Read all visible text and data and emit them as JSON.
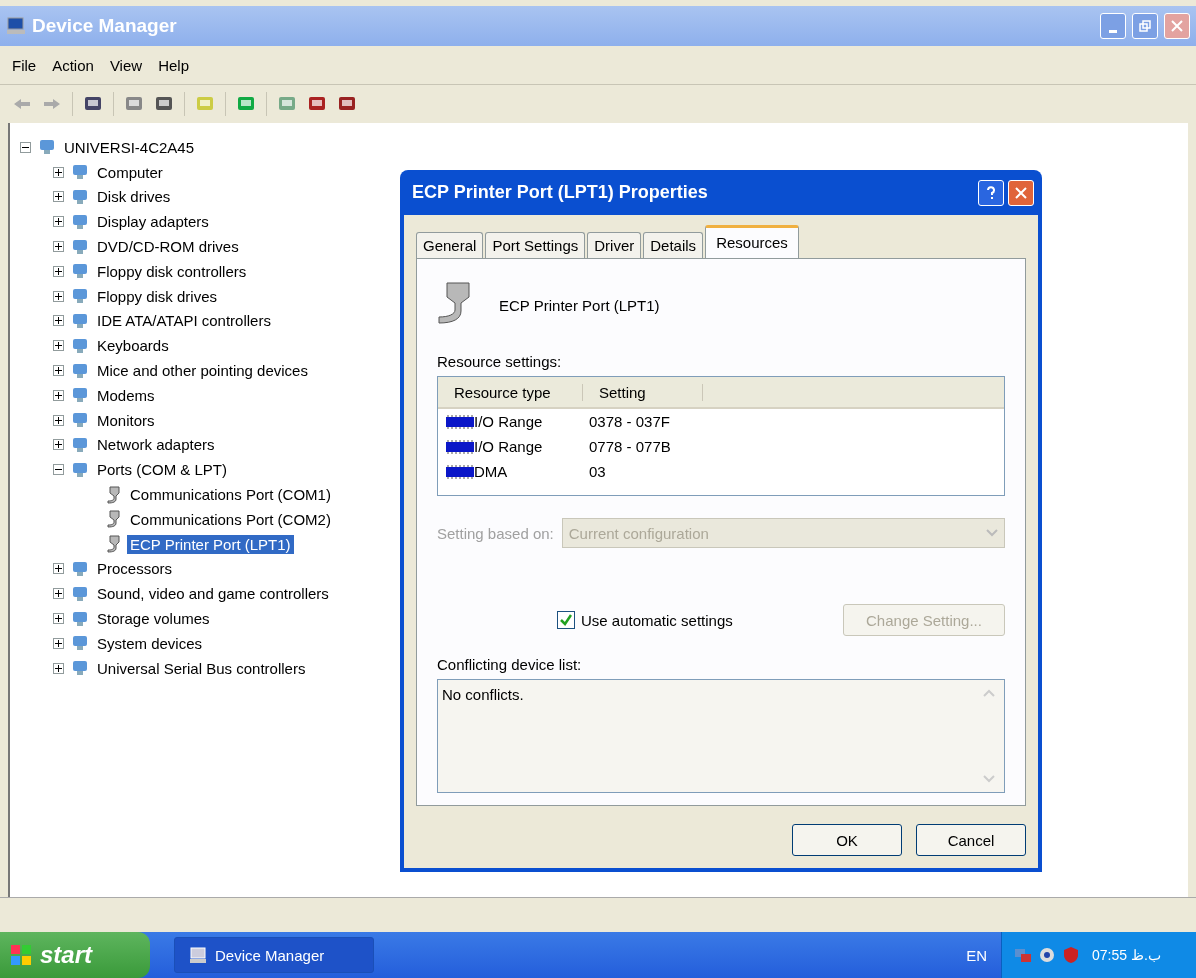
{
  "window": {
    "title": "Device Manager"
  },
  "menu": [
    "File",
    "Action",
    "View",
    "Help"
  ],
  "tree": {
    "label": "UNIVERSI-4C2A45",
    "expanded": true,
    "selected": false,
    "children": [
      {
        "label": "Computer",
        "expanded": false,
        "selected": false
      },
      {
        "label": "Disk drives",
        "expanded": false,
        "selected": false
      },
      {
        "label": "Display adapters",
        "expanded": false,
        "selected": false
      },
      {
        "label": "DVD/CD-ROM drives",
        "expanded": false,
        "selected": false
      },
      {
        "label": "Floppy disk controllers",
        "expanded": false,
        "selected": false
      },
      {
        "label": "Floppy disk drives",
        "expanded": false,
        "selected": false
      },
      {
        "label": "IDE ATA/ATAPI controllers",
        "expanded": false,
        "selected": false
      },
      {
        "label": "Keyboards",
        "expanded": false,
        "selected": false
      },
      {
        "label": "Mice and other pointing devices",
        "expanded": false,
        "selected": false
      },
      {
        "label": "Modems",
        "expanded": false,
        "selected": false
      },
      {
        "label": "Monitors",
        "expanded": false,
        "selected": false
      },
      {
        "label": "Network adapters",
        "expanded": false,
        "selected": false
      },
      {
        "label": "Ports (COM & LPT)",
        "expanded": true,
        "selected": false,
        "children": [
          {
            "label": "Communications Port (COM1)",
            "selected": false
          },
          {
            "label": "Communications Port (COM2)",
            "selected": false
          },
          {
            "label": "ECP Printer Port (LPT1)",
            "selected": true
          }
        ]
      },
      {
        "label": "Processors",
        "expanded": false,
        "selected": false
      },
      {
        "label": "Sound, video and game controllers",
        "expanded": false,
        "selected": false
      },
      {
        "label": "Storage volumes",
        "expanded": false,
        "selected": false
      },
      {
        "label": "System devices",
        "expanded": false,
        "selected": false
      },
      {
        "label": "Universal Serial Bus controllers",
        "expanded": false,
        "selected": false
      }
    ]
  },
  "dialog": {
    "title": "ECP Printer Port (LPT1) Properties",
    "tabs": [
      {
        "label": "General",
        "selected": false
      },
      {
        "label": "Port Settings",
        "selected": false
      },
      {
        "label": "Driver",
        "selected": false
      },
      {
        "label": "Details",
        "selected": false
      },
      {
        "label": "Resources",
        "selected": true
      }
    ],
    "device_name": "ECP Printer Port (LPT1)",
    "resource_label": "Resource settings:",
    "columns": [
      "Resource type",
      "Setting"
    ],
    "rows": [
      {
        "type": "I/O Range",
        "setting": "0378 - 037F"
      },
      {
        "type": "I/O Range",
        "setting": "0778 - 077B"
      },
      {
        "type": "DMA",
        "setting": "03"
      }
    ],
    "setting_based_on": {
      "label": "Setting based on:",
      "value": "Current configuration",
      "disabled": true
    },
    "automatic": {
      "label": "Use automatic settings",
      "checked": true
    },
    "change_button": {
      "label": "Change Setting...",
      "disabled": true
    },
    "conflict_label": "Conflicting device list:",
    "conflicts": "No conflicts.",
    "buttons": [
      "OK",
      "Cancel"
    ]
  },
  "taskbar": {
    "start": "start",
    "task": "Device Manager",
    "language": "EN",
    "clock": "07:55 ب.ظ"
  }
}
